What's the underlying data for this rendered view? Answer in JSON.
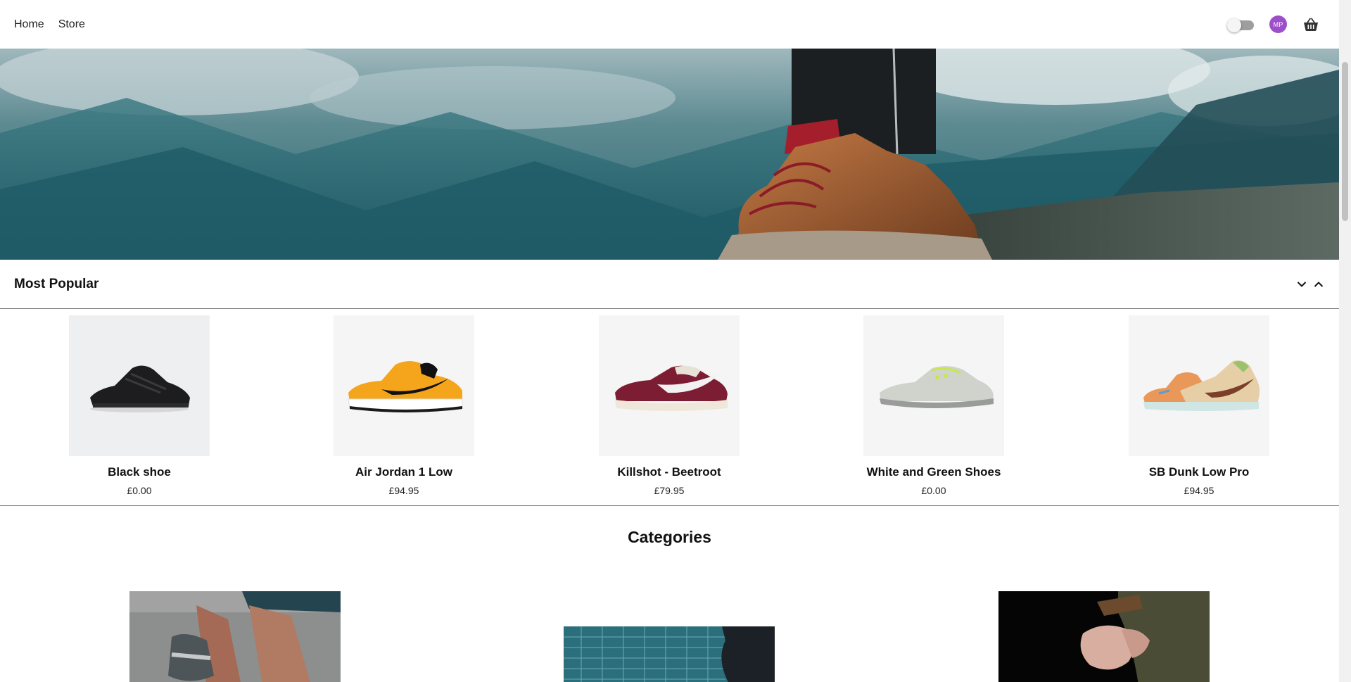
{
  "nav": {
    "links": [
      "Home",
      "Store"
    ],
    "avatar_initials": "MP"
  },
  "popular": {
    "title": "Most Popular",
    "products": [
      {
        "name": "Black shoe",
        "price": "£0.00"
      },
      {
        "name": "Air Jordan 1 Low",
        "price": "£94.95"
      },
      {
        "name": "Killshot - Beetroot",
        "price": "£79.95"
      },
      {
        "name": "White and Green Shoes",
        "price": "£0.00"
      },
      {
        "name": "SB Dunk Low Pro",
        "price": "£94.95"
      }
    ]
  },
  "categories": {
    "title": "Categories"
  },
  "colors": {
    "avatar": "#9c4fc9",
    "divider": "#777777"
  }
}
